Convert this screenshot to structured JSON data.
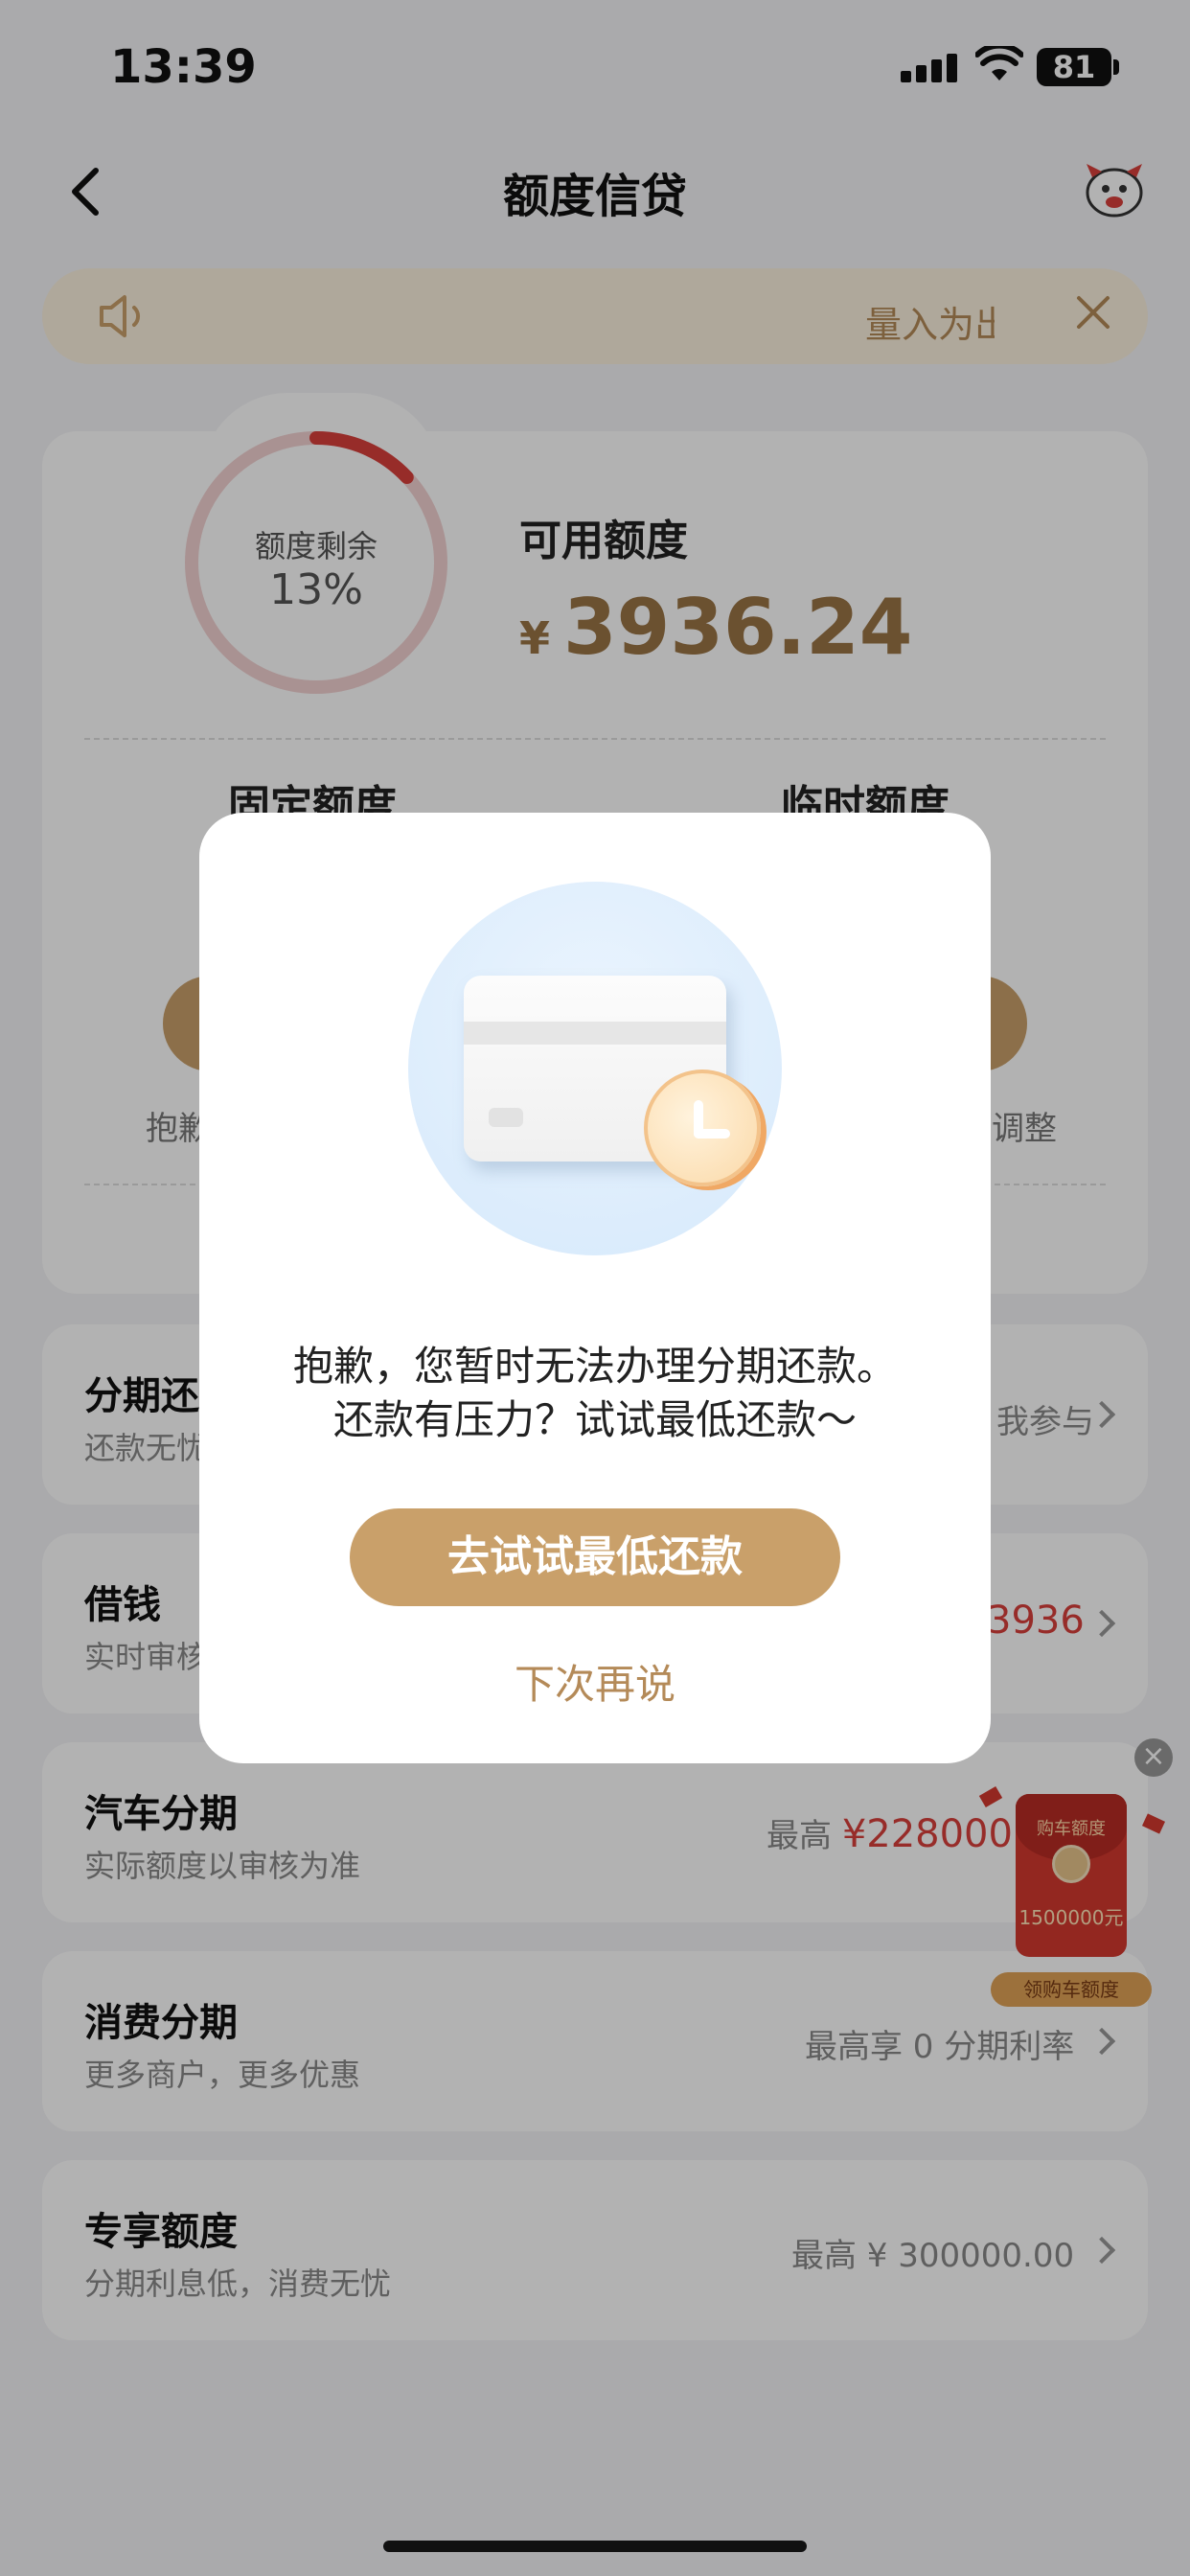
{
  "status_bar": {
    "time": "13:39",
    "battery": "81"
  },
  "nav": {
    "title": "额度信贷"
  },
  "notice": {
    "text": "量入为出"
  },
  "quota": {
    "ring_label": "额度剩余",
    "ring_percent": "13%",
    "remaining_fraction": 0.13,
    "available_label": "可用额度",
    "currency": "¥",
    "available_amount": "3936.24",
    "fixed_label": "固定额度",
    "temp_label": "临时额度",
    "sorry_partial": "抱歉",
    "adjust_partial": "调整"
  },
  "rows": [
    {
      "title": "分期还",
      "sub": "还款无忧",
      "right": "我参与"
    },
    {
      "title": "借钱",
      "sub": "实时审核",
      "right_prefix": "",
      "right_value": "3936"
    },
    {
      "title": "汽车分期",
      "sub": "实际额度以审核为准",
      "right_prefix": "最高",
      "right_value": "¥228000"
    },
    {
      "title": "消费分期",
      "sub": "更多商户，更多优惠",
      "right": "最高享 0 分期利率"
    },
    {
      "title": "专享额度",
      "sub": "分期利息低，消费无忧",
      "right": "最高 ¥ 300000.00"
    }
  ],
  "float_packet": {
    "top_text": "购车额度",
    "amount": "1500000元",
    "tag": "领购车额度",
    "close": "×"
  },
  "modal": {
    "line1": "抱歉，您暂时无法办理分期还款。",
    "line2": "还款有压力？试试最低还款～",
    "primary_button": "去试试最低还款",
    "secondary_button": "下次再说"
  },
  "colors": {
    "accent": "#c9a06a",
    "amount": "#9a7446",
    "red": "#d8403c",
    "ring_track": "#f3d2d2",
    "ring_fill": "#d8403c"
  }
}
